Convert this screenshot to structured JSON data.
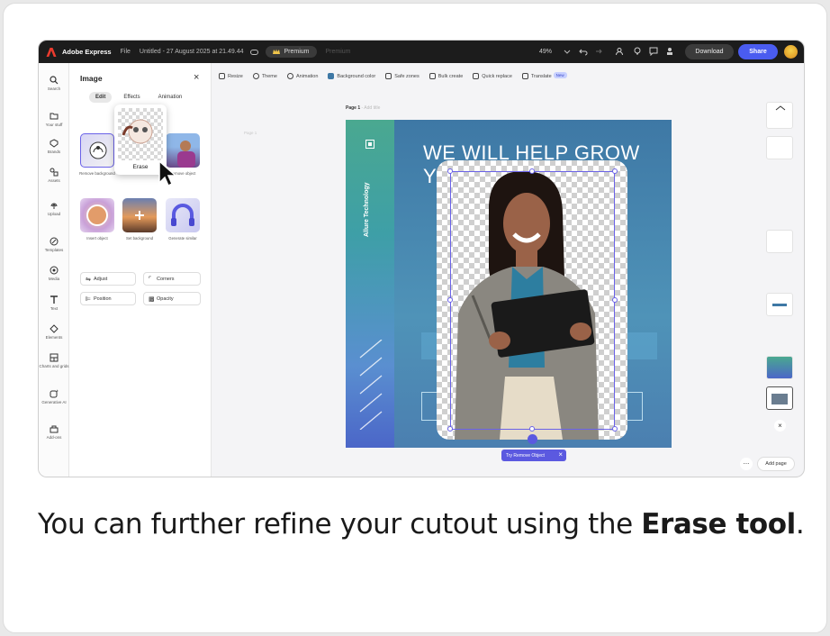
{
  "topbar": {
    "brand": "Adobe Express",
    "file": "File",
    "doc_title": "Untitled - 27 August 2025 at 21.49.44",
    "premium": "Premium",
    "premium2": "Premium",
    "zoom": "49%",
    "download": "Download",
    "share": "Share"
  },
  "rail": [
    {
      "label": "Search",
      "icon": "search-icon"
    },
    {
      "label": "Your stuff",
      "icon": "folder-icon"
    },
    {
      "label": "Brands",
      "icon": "brand-icon"
    },
    {
      "label": "Assets",
      "icon": "assets-icon"
    },
    {
      "label": "Upload",
      "icon": "upload-icon"
    },
    {
      "label": "Templates",
      "icon": "templates-icon"
    },
    {
      "label": "Media",
      "icon": "media-icon"
    },
    {
      "label": "Text",
      "icon": "text-icon"
    },
    {
      "label": "Elements",
      "icon": "elements-icon"
    },
    {
      "label": "Charts and grids",
      "icon": "grid-icon"
    },
    {
      "label": "Generative AI",
      "icon": "sparkle-icon"
    },
    {
      "label": "Add-ons",
      "icon": "addons-icon"
    }
  ],
  "panel": {
    "title": "Image",
    "tabs": [
      "Edit",
      "Effects",
      "Animation"
    ],
    "actions": [
      {
        "label": "Remove background"
      },
      {
        "label": "Remove object"
      },
      {
        "label": "Insert object"
      },
      {
        "label": "Set background"
      },
      {
        "label": "Generate similar"
      }
    ],
    "erase_label": "Erase",
    "pills": [
      "Adjust",
      "Corners",
      "Position",
      "Opacity"
    ]
  },
  "toolbar": [
    "Resize",
    "Theme",
    "Animation",
    "Background color",
    "Safe zones",
    "Bulk create",
    "Quick replace",
    "Translate"
  ],
  "translate_badge": "New",
  "canvas": {
    "page_label": "Page 1",
    "page_label_suffix": "- Add title",
    "page_label_left": "Page 1",
    "headline_line1": "WE WILL HELP GROW",
    "headline_line2": "Y",
    "vertical_text": "Allure Technology",
    "try_remove": "Try Remove Object"
  },
  "right_panel": {
    "add_page": "Add page",
    "more": "..."
  },
  "caption": {
    "prefix": "You can further refine your cutout using the ",
    "bold": "Erase tool",
    "suffix": "."
  },
  "colors": {
    "accent": "#4a5cf0",
    "selection": "#6a62e8"
  }
}
